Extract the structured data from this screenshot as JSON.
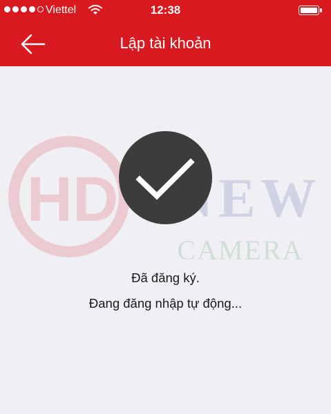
{
  "status_bar": {
    "carrier": "Viettel",
    "time": "12:38",
    "signal_bars_filled": 4,
    "signal_bars_total": 5,
    "battery_level": 0.85
  },
  "header": {
    "title": "Lập tài khoản",
    "back_icon": "arrow-left-icon"
  },
  "watermark": {
    "brand_mark": "HD",
    "word1": "NEW",
    "word2": "CAMERA"
  },
  "success": {
    "icon": "checkmark-icon",
    "line1": "Đã đăng ký.",
    "line2": "Đang đăng nhập tự động..."
  },
  "colors": {
    "header_bg": "#d81920",
    "page_bg": "#efeff4",
    "circle_bg": "#3c3c3d"
  }
}
